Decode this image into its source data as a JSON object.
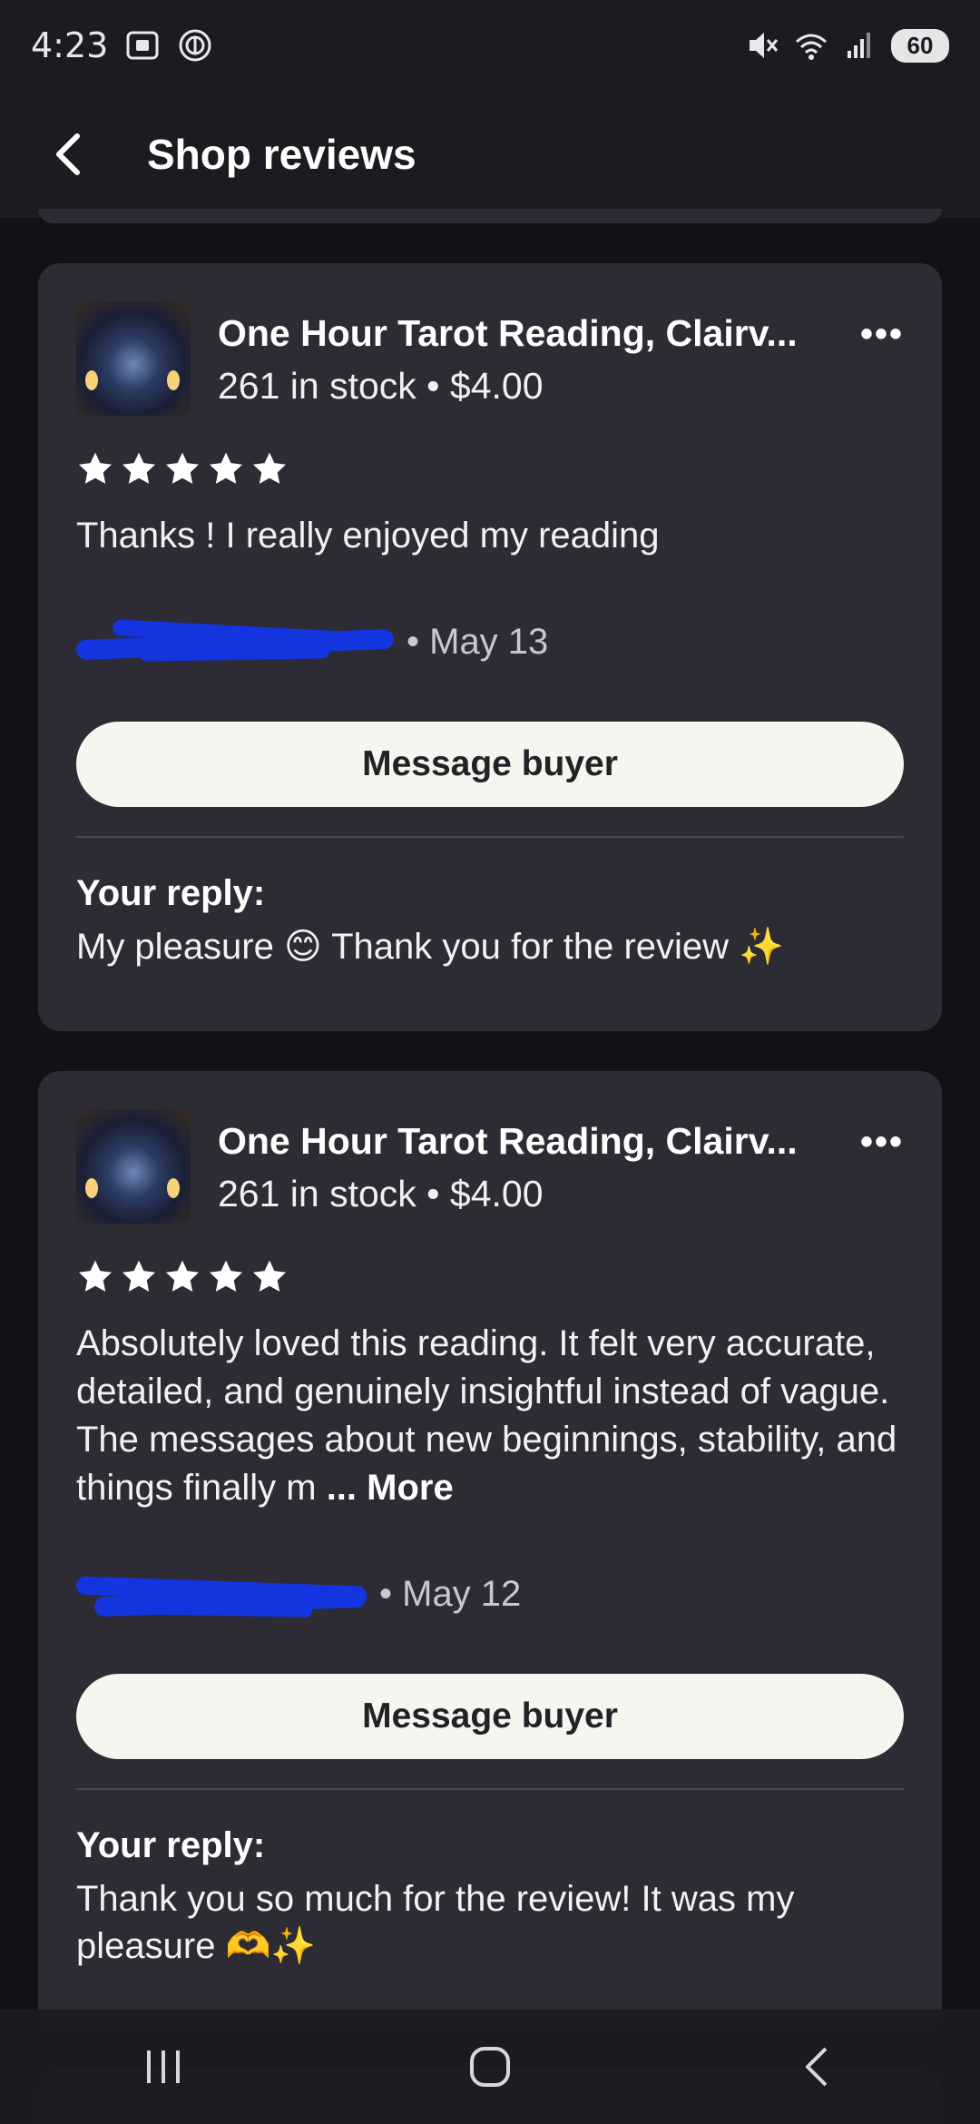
{
  "status_bar": {
    "time": "4:23",
    "battery": "60"
  },
  "app_bar": {
    "title": "Shop reviews"
  },
  "reviews": [
    {
      "listing_title": "One Hour Tarot Reading, Clairv...",
      "listing_meta": "261 in stock • $4.00",
      "rating": 5,
      "text": "Thanks ! I really enjoyed my reading",
      "date": "• May 13",
      "message_button": "Message buyer",
      "reply_label": "Your reply:",
      "reply_text": "My pleasure 😊 Thank you for the review ✨"
    },
    {
      "listing_title": "One Hour Tarot Reading, Clairv...",
      "listing_meta": "261 in stock • $4.00",
      "rating": 5,
      "text": "Absolutely loved this reading. It felt very accurate, detailed, and genuinely insightful instead of vague. The messages about new beginnings, stability, and things finally m",
      "more_label": "... More",
      "date": "• May 12",
      "message_button": "Message buyer",
      "reply_label": "Your reply:",
      "reply_text": "Thank you so much for the review! It was my pleasure 🫶✨"
    }
  ],
  "more_icon": "•••",
  "colors": {
    "background": "#121115",
    "card": "#2d2b33",
    "button": "#f7f5ef",
    "redaction": "#1434e0"
  }
}
